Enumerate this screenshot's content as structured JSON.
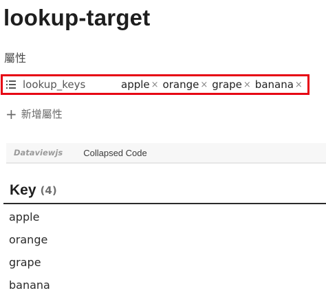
{
  "page": {
    "title": "lookup-target",
    "properties_heading": "屬性"
  },
  "property": {
    "key": "lookup_keys",
    "icon": "list-icon",
    "values": [
      "apple",
      "orange",
      "grape",
      "banana"
    ],
    "remove_glyph": "×",
    "highlight_color": "#e60012"
  },
  "add_property": {
    "icon": "plus-icon",
    "label": "新增屬性"
  },
  "code_block": {
    "language": "Dataviewjs",
    "collapsed_label": "Collapsed Code"
  },
  "table": {
    "header": "Key",
    "count": "(4)",
    "rows": [
      "apple",
      "orange",
      "grape",
      "banana"
    ]
  }
}
